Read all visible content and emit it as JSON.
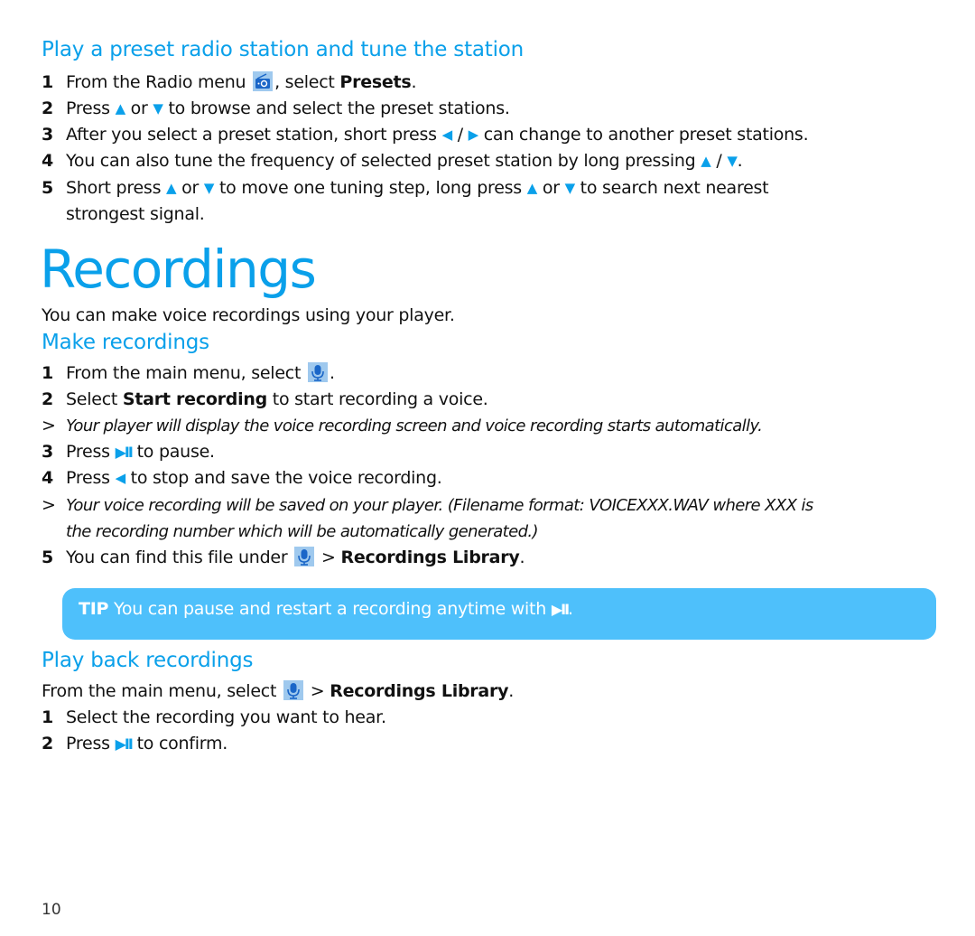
{
  "radio_section": {
    "heading": "Play a preset radio station and tune the station",
    "steps": [
      {
        "num": "1",
        "pre": "From the Radio menu",
        "icon": "radio-icon",
        "mid": ", select ",
        "bold": "Presets",
        "post": "."
      },
      {
        "num": "2",
        "a": "Press",
        "up": "▲",
        "b": "or",
        "down": "▼",
        "c": "to browse and select the preset stations."
      },
      {
        "num": "3",
        "a": "After you select a preset station, short press",
        "left": "◀",
        "sep": "/",
        "right": "▶",
        "c": "can change to another preset stations."
      },
      {
        "num": "4",
        "a": "You can also tune the frequency of selected preset station by long pressing",
        "up": "▲",
        "sep": "/",
        "down": "▼",
        "c": "."
      },
      {
        "num": "5",
        "a": "Short press",
        "up": "▲",
        "b": "or",
        "down": "▼",
        "c": "to move one tuning step, long press",
        "up2": "▲",
        "d": "or",
        "down2": "▼",
        "e": "to search next nearest",
        "wrap": "strongest signal."
      }
    ]
  },
  "recordings": {
    "title": "Recordings",
    "intro": "You can make voice recordings using your player.",
    "make": {
      "heading": "Make recordings",
      "step1": {
        "num": "1",
        "text": "From the main menu, select",
        "icon": "microphone-icon",
        "post": "."
      },
      "step2": {
        "num": "2",
        "pre": "Select ",
        "bold": "Start recording",
        "post": " to start recording a voice."
      },
      "note1": {
        "marker": ">",
        "text": "Your player will display the voice recording screen and voice recording starts automatically."
      },
      "step3": {
        "num": "3",
        "pre": "Press",
        "glyph": "▶II",
        "post": "to pause."
      },
      "step4": {
        "num": "4",
        "pre": "Press",
        "glyph": "◀",
        "post": "to stop and save the voice recording."
      },
      "note2": {
        "marker": ">",
        "line1": "Your voice recording will be saved on your player. (Filename format: VOICEXXX.WAV where XXX is",
        "line2": "the recording number which will be automatically generated.)"
      },
      "step5": {
        "num": "5",
        "pre": "You can find this file under",
        "icon": "microphone-icon",
        "mid": " > ",
        "bold": "Recordings Library",
        "post": "."
      }
    },
    "tip": {
      "label": "TIP",
      "text": "You can pause and restart a recording anytime with",
      "glyph": "▶II",
      "post": "."
    },
    "playback": {
      "heading": "Play back recordings",
      "intro": {
        "pre": "From the main menu, select",
        "icon": "microphone-icon",
        "mid": " > ",
        "bold": "Recordings Library",
        "post": "."
      },
      "step1": {
        "num": "1",
        "text": "Select the recording you want to hear."
      },
      "step2": {
        "num": "2",
        "pre": "Press",
        "glyph": "▶II",
        "post": "to confirm."
      }
    }
  },
  "footer": {
    "page_number": "10"
  },
  "colors": {
    "accent": "#0aa0ea",
    "tip_background": "#4ec0fb",
    "icon_background": "#9fc9ee"
  }
}
